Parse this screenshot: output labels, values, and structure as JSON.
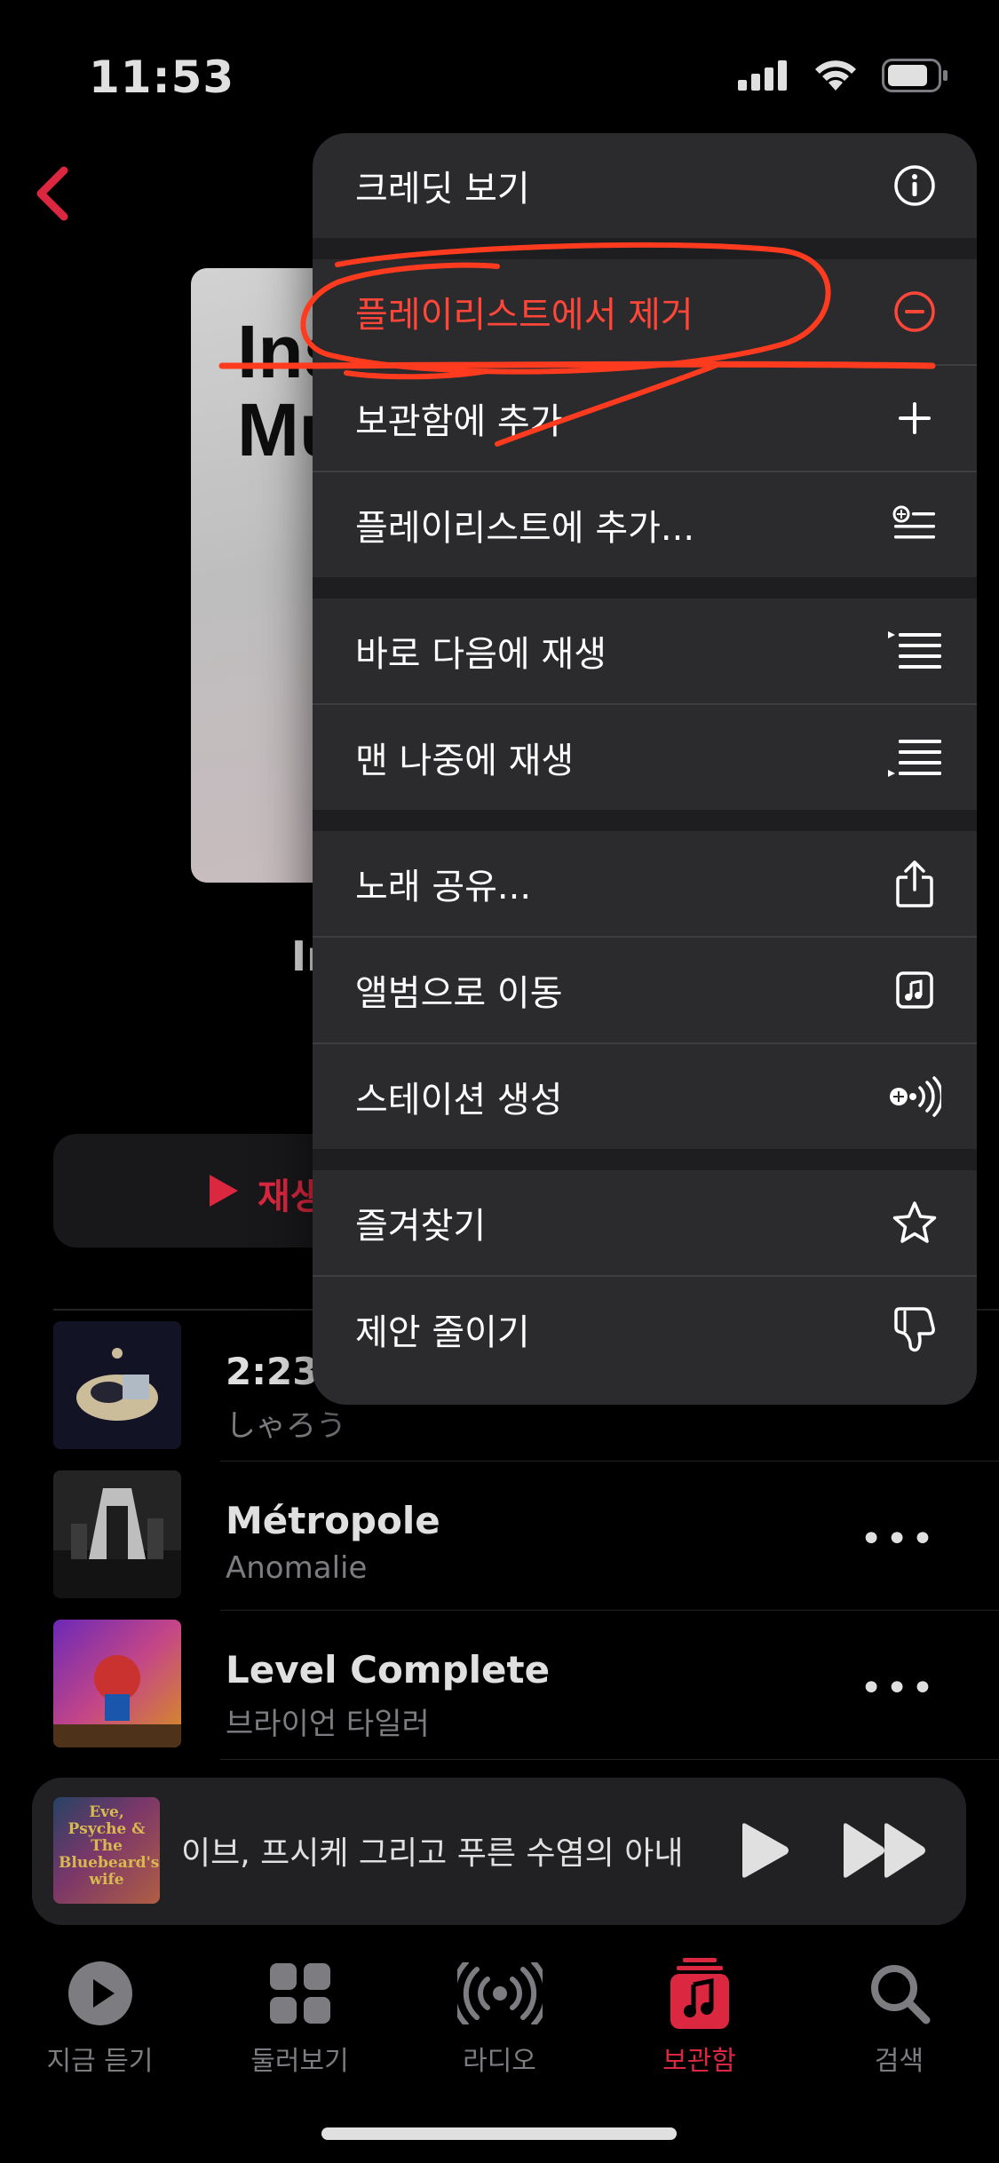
{
  "status_bar": {
    "time": "11:53"
  },
  "background": {
    "artwork_title_lines": [
      "Ins",
      "Mu"
    ],
    "page_title": "In",
    "play_label": "재생"
  },
  "menu": {
    "items": [
      {
        "label": "크레딧 보기",
        "icon": "info-icon"
      },
      {
        "label": "플레이리스트에서 제거",
        "icon": "minus-circle-icon",
        "destructive": true
      },
      {
        "label": "보관함에 추가",
        "icon": "plus-icon"
      },
      {
        "label": "플레이리스트에 추가...",
        "icon": "add-to-playlist-icon"
      },
      {
        "label": "바로 다음에 재생",
        "icon": "play-next-icon"
      },
      {
        "label": "맨 나중에 재생",
        "icon": "play-last-icon"
      },
      {
        "label": "노래 공유...",
        "icon": "share-icon"
      },
      {
        "label": "앨범으로 이동",
        "icon": "album-icon"
      },
      {
        "label": "스테이션 생성",
        "icon": "station-icon"
      },
      {
        "label": "즐겨찾기",
        "icon": "star-icon"
      },
      {
        "label": "제안 줄이기",
        "icon": "thumbs-down-icon"
      }
    ]
  },
  "songs": [
    {
      "title": "2:23",
      "artist": "しゃろう"
    },
    {
      "title": "Métropole",
      "artist": "Anomalie"
    },
    {
      "title": "Level Complete",
      "artist": "브라이언 타일러"
    }
  ],
  "mini_player": {
    "title": "이브, 프시케 그리고 푸른 수염의 아내",
    "art_text": "Eve, Psyche & The Bluebeard's wife"
  },
  "tabs": [
    {
      "label": "지금 듣기",
      "icon": "play-circle-icon"
    },
    {
      "label": "둘러보기",
      "icon": "grid-icon"
    },
    {
      "label": "라디오",
      "icon": "radio-icon"
    },
    {
      "label": "보관함",
      "icon": "library-icon",
      "active": true
    },
    {
      "label": "검색",
      "icon": "search-icon"
    }
  ],
  "colors": {
    "accent": "#fa2d48",
    "destructive": "#ff4639",
    "annotation": "#ff3b1f"
  }
}
